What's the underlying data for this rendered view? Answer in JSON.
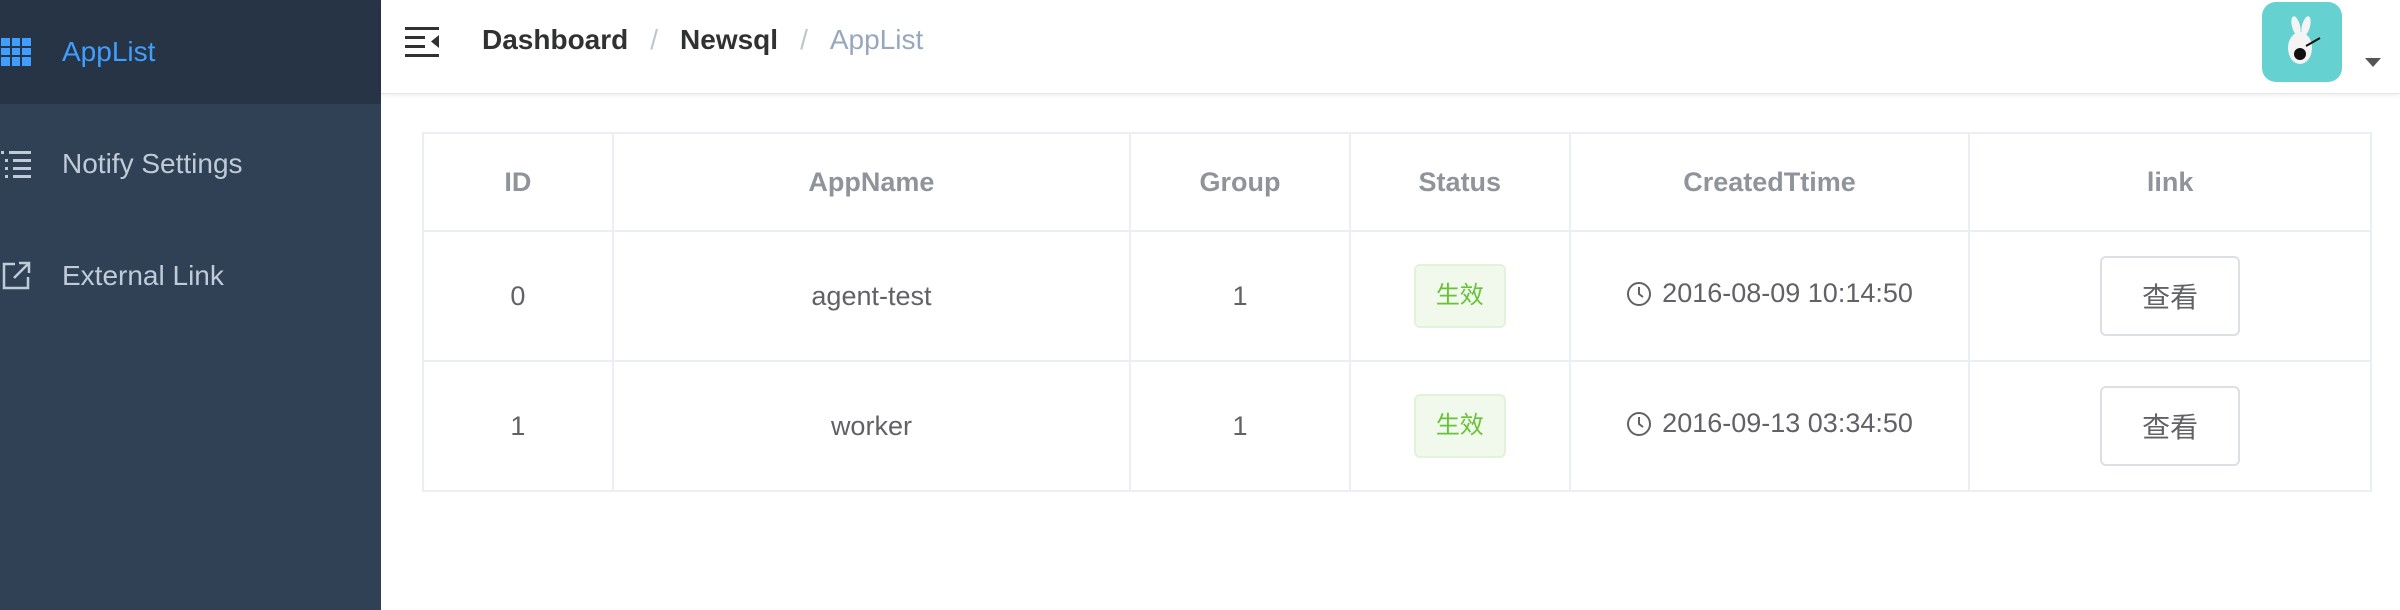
{
  "sidebar": {
    "items": [
      {
        "label": "AppList",
        "icon": "table-icon",
        "active": true
      },
      {
        "label": "Notify Settings",
        "icon": "list-icon",
        "active": false
      },
      {
        "label": "External Link",
        "icon": "external-link-icon",
        "active": false
      }
    ],
    "colors": {
      "background": "#304156",
      "active_background": "#263445",
      "active_text": "#409eff",
      "text": "#bfcbd9"
    }
  },
  "header": {
    "breadcrumb": [
      "Dashboard",
      "Newsql",
      "AppList"
    ],
    "separator": "/",
    "avatar_icon": "user-avatar"
  },
  "table": {
    "columns": [
      "ID",
      "AppName",
      "Group",
      "Status",
      "CreatedTtime",
      "link"
    ],
    "rows": [
      {
        "id": "0",
        "app_name": "agent-test",
        "group": "1",
        "status": "生效",
        "created": "2016-08-09 10:14:50",
        "link": "查看"
      },
      {
        "id": "1",
        "app_name": "worker",
        "group": "1",
        "status": "生效",
        "created": "2016-09-13 03:34:50",
        "link": "查看"
      }
    ]
  },
  "colors": {
    "tag_success": "#67c23a",
    "accent": "#409eff"
  }
}
